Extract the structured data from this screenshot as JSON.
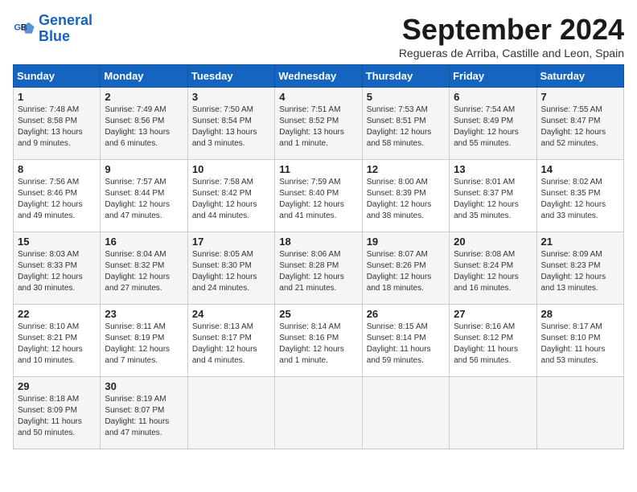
{
  "header": {
    "logo_line1": "General",
    "logo_line2": "Blue",
    "month_title": "September 2024",
    "subtitle": "Regueras de Arriba, Castille and Leon, Spain"
  },
  "days_of_week": [
    "Sunday",
    "Monday",
    "Tuesday",
    "Wednesday",
    "Thursday",
    "Friday",
    "Saturday"
  ],
  "weeks": [
    [
      {
        "day": "1",
        "sunrise": "Sunrise: 7:48 AM",
        "sunset": "Sunset: 8:58 PM",
        "daylight": "Daylight: 13 hours and 9 minutes."
      },
      {
        "day": "2",
        "sunrise": "Sunrise: 7:49 AM",
        "sunset": "Sunset: 8:56 PM",
        "daylight": "Daylight: 13 hours and 6 minutes."
      },
      {
        "day": "3",
        "sunrise": "Sunrise: 7:50 AM",
        "sunset": "Sunset: 8:54 PM",
        "daylight": "Daylight: 13 hours and 3 minutes."
      },
      {
        "day": "4",
        "sunrise": "Sunrise: 7:51 AM",
        "sunset": "Sunset: 8:52 PM",
        "daylight": "Daylight: 13 hours and 1 minute."
      },
      {
        "day": "5",
        "sunrise": "Sunrise: 7:53 AM",
        "sunset": "Sunset: 8:51 PM",
        "daylight": "Daylight: 12 hours and 58 minutes."
      },
      {
        "day": "6",
        "sunrise": "Sunrise: 7:54 AM",
        "sunset": "Sunset: 8:49 PM",
        "daylight": "Daylight: 12 hours and 55 minutes."
      },
      {
        "day": "7",
        "sunrise": "Sunrise: 7:55 AM",
        "sunset": "Sunset: 8:47 PM",
        "daylight": "Daylight: 12 hours and 52 minutes."
      }
    ],
    [
      {
        "day": "8",
        "sunrise": "Sunrise: 7:56 AM",
        "sunset": "Sunset: 8:46 PM",
        "daylight": "Daylight: 12 hours and 49 minutes."
      },
      {
        "day": "9",
        "sunrise": "Sunrise: 7:57 AM",
        "sunset": "Sunset: 8:44 PM",
        "daylight": "Daylight: 12 hours and 47 minutes."
      },
      {
        "day": "10",
        "sunrise": "Sunrise: 7:58 AM",
        "sunset": "Sunset: 8:42 PM",
        "daylight": "Daylight: 12 hours and 44 minutes."
      },
      {
        "day": "11",
        "sunrise": "Sunrise: 7:59 AM",
        "sunset": "Sunset: 8:40 PM",
        "daylight": "Daylight: 12 hours and 41 minutes."
      },
      {
        "day": "12",
        "sunrise": "Sunrise: 8:00 AM",
        "sunset": "Sunset: 8:39 PM",
        "daylight": "Daylight: 12 hours and 38 minutes."
      },
      {
        "day": "13",
        "sunrise": "Sunrise: 8:01 AM",
        "sunset": "Sunset: 8:37 PM",
        "daylight": "Daylight: 12 hours and 35 minutes."
      },
      {
        "day": "14",
        "sunrise": "Sunrise: 8:02 AM",
        "sunset": "Sunset: 8:35 PM",
        "daylight": "Daylight: 12 hours and 33 minutes."
      }
    ],
    [
      {
        "day": "15",
        "sunrise": "Sunrise: 8:03 AM",
        "sunset": "Sunset: 8:33 PM",
        "daylight": "Daylight: 12 hours and 30 minutes."
      },
      {
        "day": "16",
        "sunrise": "Sunrise: 8:04 AM",
        "sunset": "Sunset: 8:32 PM",
        "daylight": "Daylight: 12 hours and 27 minutes."
      },
      {
        "day": "17",
        "sunrise": "Sunrise: 8:05 AM",
        "sunset": "Sunset: 8:30 PM",
        "daylight": "Daylight: 12 hours and 24 minutes."
      },
      {
        "day": "18",
        "sunrise": "Sunrise: 8:06 AM",
        "sunset": "Sunset: 8:28 PM",
        "daylight": "Daylight: 12 hours and 21 minutes."
      },
      {
        "day": "19",
        "sunrise": "Sunrise: 8:07 AM",
        "sunset": "Sunset: 8:26 PM",
        "daylight": "Daylight: 12 hours and 18 minutes."
      },
      {
        "day": "20",
        "sunrise": "Sunrise: 8:08 AM",
        "sunset": "Sunset: 8:24 PM",
        "daylight": "Daylight: 12 hours and 16 minutes."
      },
      {
        "day": "21",
        "sunrise": "Sunrise: 8:09 AM",
        "sunset": "Sunset: 8:23 PM",
        "daylight": "Daylight: 12 hours and 13 minutes."
      }
    ],
    [
      {
        "day": "22",
        "sunrise": "Sunrise: 8:10 AM",
        "sunset": "Sunset: 8:21 PM",
        "daylight": "Daylight: 12 hours and 10 minutes."
      },
      {
        "day": "23",
        "sunrise": "Sunrise: 8:11 AM",
        "sunset": "Sunset: 8:19 PM",
        "daylight": "Daylight: 12 hours and 7 minutes."
      },
      {
        "day": "24",
        "sunrise": "Sunrise: 8:13 AM",
        "sunset": "Sunset: 8:17 PM",
        "daylight": "Daylight: 12 hours and 4 minutes."
      },
      {
        "day": "25",
        "sunrise": "Sunrise: 8:14 AM",
        "sunset": "Sunset: 8:16 PM",
        "daylight": "Daylight: 12 hours and 1 minute."
      },
      {
        "day": "26",
        "sunrise": "Sunrise: 8:15 AM",
        "sunset": "Sunset: 8:14 PM",
        "daylight": "Daylight: 11 hours and 59 minutes."
      },
      {
        "day": "27",
        "sunrise": "Sunrise: 8:16 AM",
        "sunset": "Sunset: 8:12 PM",
        "daylight": "Daylight: 11 hours and 56 minutes."
      },
      {
        "day": "28",
        "sunrise": "Sunrise: 8:17 AM",
        "sunset": "Sunset: 8:10 PM",
        "daylight": "Daylight: 11 hours and 53 minutes."
      }
    ],
    [
      {
        "day": "29",
        "sunrise": "Sunrise: 8:18 AM",
        "sunset": "Sunset: 8:09 PM",
        "daylight": "Daylight: 11 hours and 50 minutes."
      },
      {
        "day": "30",
        "sunrise": "Sunrise: 8:19 AM",
        "sunset": "Sunset: 8:07 PM",
        "daylight": "Daylight: 11 hours and 47 minutes."
      },
      {
        "day": "",
        "sunrise": "",
        "sunset": "",
        "daylight": ""
      },
      {
        "day": "",
        "sunrise": "",
        "sunset": "",
        "daylight": ""
      },
      {
        "day": "",
        "sunrise": "",
        "sunset": "",
        "daylight": ""
      },
      {
        "day": "",
        "sunrise": "",
        "sunset": "",
        "daylight": ""
      },
      {
        "day": "",
        "sunrise": "",
        "sunset": "",
        "daylight": ""
      }
    ]
  ]
}
